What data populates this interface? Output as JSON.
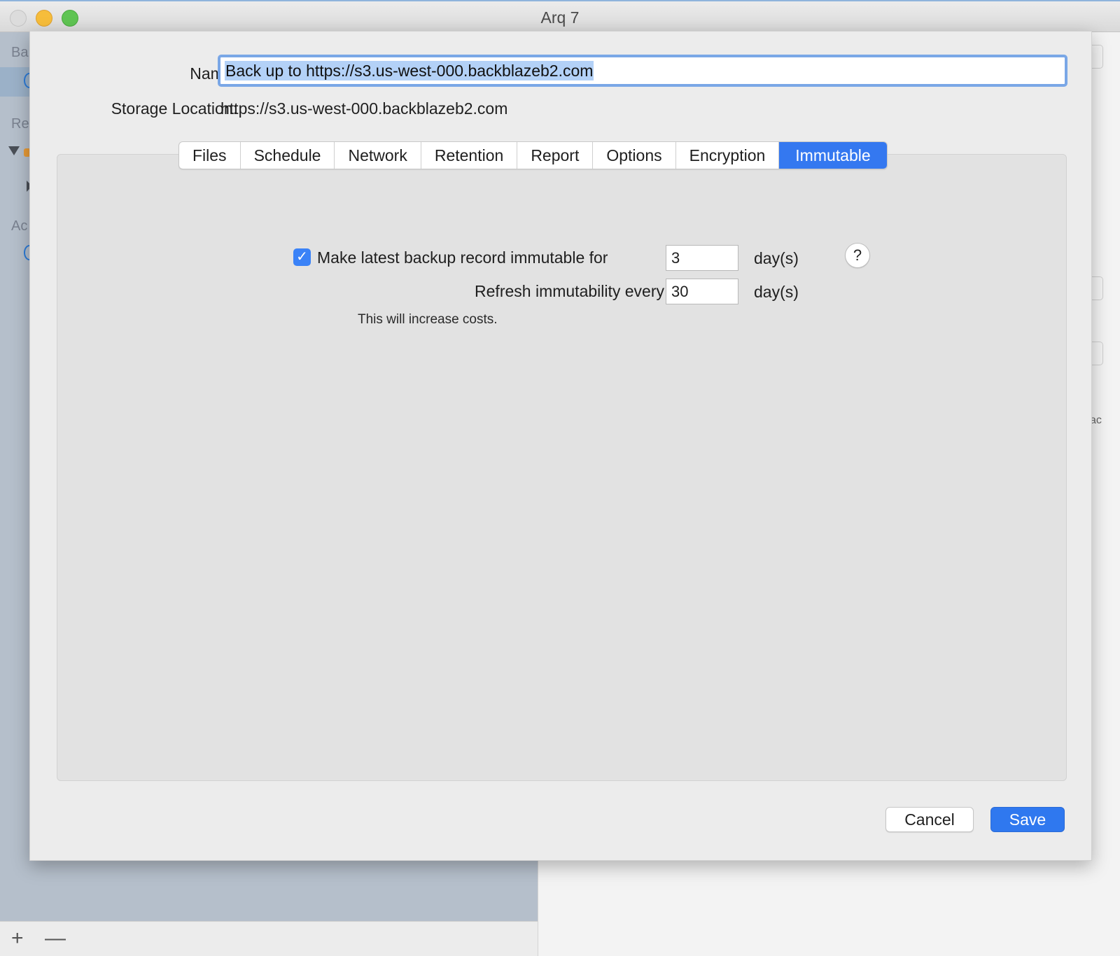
{
  "window": {
    "title": "Arq 7"
  },
  "background": {
    "sidebar_sections": [
      "Ba",
      "Re",
      "Ac"
    ],
    "right_edge_text": "ac",
    "bottom_bar": {
      "add_symbol": "+",
      "remove_symbol": "—"
    }
  },
  "sheet": {
    "name_label": "Name:",
    "name_value": "Back up to https://s3.us-west-000.backblazeb2.com",
    "storage_label": "Storage Location:",
    "storage_value": "https://s3.us-west-000.backblazeb2.com",
    "tabs": [
      {
        "label": "Files"
      },
      {
        "label": "Schedule"
      },
      {
        "label": "Network"
      },
      {
        "label": "Retention"
      },
      {
        "label": "Report"
      },
      {
        "label": "Options"
      },
      {
        "label": "Encryption"
      },
      {
        "label": "Immutable",
        "active": true
      }
    ],
    "immutable": {
      "checkbox_checked": true,
      "checkbox_label": "Make latest backup record immutable for",
      "immutable_days": "3",
      "days_unit": "day(s)",
      "refresh_label": "Refresh immutability every",
      "refresh_days": "30",
      "help_symbol": "?",
      "note": "This will increase costs."
    },
    "buttons": {
      "cancel": "Cancel",
      "save": "Save"
    }
  },
  "colors": {
    "accent": "#3478f0",
    "selection": "#b3d1f7",
    "focus_ring": "#7aa7e6"
  }
}
